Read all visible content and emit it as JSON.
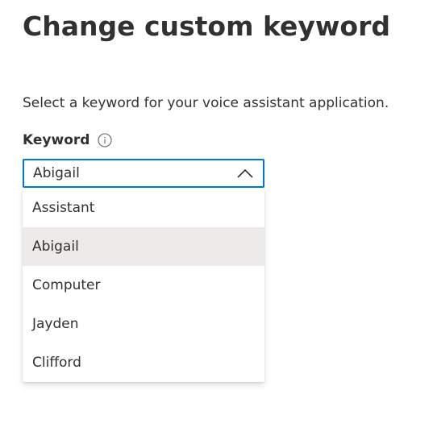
{
  "page": {
    "title": "Change custom keyword",
    "description": "Select a keyword for your voice assistant application."
  },
  "keyword_field": {
    "label": "Keyword",
    "info_icon": "info-icon",
    "chevron_icon": "chevron-up-icon",
    "selected_value": "Abigail",
    "expanded": true,
    "options": [
      {
        "label": "Assistant",
        "selected": false
      },
      {
        "label": "Abigail",
        "selected": true
      },
      {
        "label": "Computer",
        "selected": false
      },
      {
        "label": "Jayden",
        "selected": false
      },
      {
        "label": "Clifford",
        "selected": false
      }
    ]
  },
  "colors": {
    "accent": "#0078d4",
    "text": "#323130",
    "selected_option_bg": "#edebe9"
  }
}
